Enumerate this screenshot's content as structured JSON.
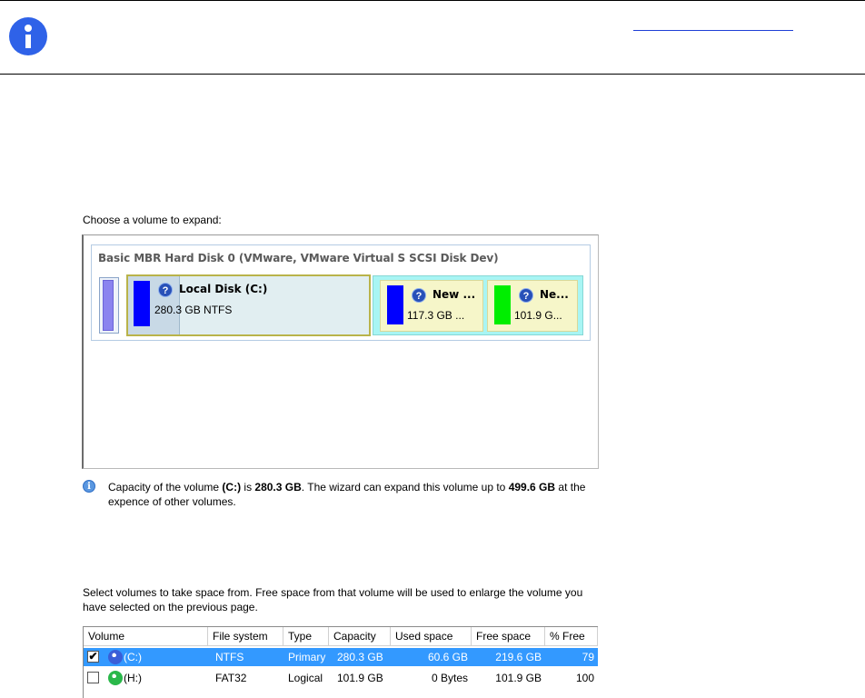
{
  "choose_label": "Choose a volume to expand:",
  "disk": {
    "title": "Basic MBR Hard Disk 0 (VMware, VMware Virtual S SCSI Disk Dev)",
    "volumes": [
      {
        "name": "Local Disk (C:)",
        "size": "280.3 GB NTFS",
        "color": "#0000ff"
      },
      {
        "name": "New ...",
        "size": "117.3 GB ...",
        "color": "#0000ff"
      },
      {
        "name": "Ne...",
        "size": "101.9 G...",
        "color": "#00ee00"
      }
    ],
    "help_glyph": "?"
  },
  "note": {
    "icon_glyph": "i",
    "t1": "Capacity of the volume ",
    "b1": "(C:)",
    "t2": " is ",
    "b2": "280.3 GB",
    "t3": ". The wizard can expand this volume up to ",
    "b3": "499.6 GB",
    "t4": " at the expence of other volumes."
  },
  "select_text": "Select volumes to take space from. Free space from that volume will be used to enlarge the volume you have selected on the previous page.",
  "table": {
    "columns": [
      "Volume",
      "File system",
      "Type",
      "Capacity",
      "Used space",
      "Free space",
      "% Free"
    ],
    "rows": [
      {
        "checked": true,
        "check_glyph": "✔",
        "volume": "(C:)",
        "fs": "NTFS",
        "type": "Primary",
        "capacity": "280.3 GB",
        "used": "60.6 GB",
        "free": "219.6 GB",
        "pct": "79",
        "icon_color": "#3a5ed8"
      },
      {
        "checked": false,
        "check_glyph": "",
        "volume": "(H:)",
        "fs": "FAT32",
        "type": "Logical",
        "capacity": "101.9 GB",
        "used": "0 Bytes",
        "free": "101.9 GB",
        "pct": "100",
        "icon_color": "#2ab84a"
      }
    ]
  },
  "colors": {
    "accent": "#3399ff",
    "banner_icon": "#2f62e8"
  }
}
